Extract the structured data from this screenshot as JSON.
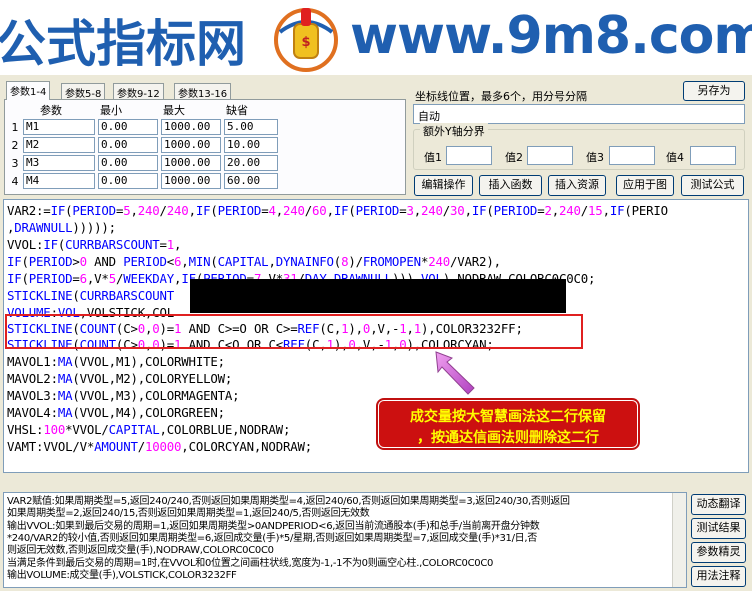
{
  "banner": {
    "left_text": "公式指标网",
    "right_text": "www.9m8.com",
    "logo_text": "9m8.com"
  },
  "tabs": [
    "参数1-4",
    "参数5-8",
    "参数9-12",
    "参数13-16"
  ],
  "params": {
    "headers": [
      "参数",
      "最小",
      "最大",
      "缺省"
    ],
    "rows": [
      {
        "num": "1",
        "name": "M1",
        "min": "0.00",
        "max": "1000.00",
        "default": "5.00"
      },
      {
        "num": "2",
        "name": "M2",
        "min": "0.00",
        "max": "1000.00",
        "default": "10.00"
      },
      {
        "num": "3",
        "name": "M3",
        "min": "0.00",
        "max": "1000.00",
        "default": "20.00"
      },
      {
        "num": "4",
        "name": "M4",
        "min": "0.00",
        "max": "1000.00",
        "default": "60.00"
      }
    ]
  },
  "options": {
    "coord_label": "坐标线位置，最多6个，用分号分隔",
    "coord_value": "自动",
    "saveas_label": "另存为",
    "yaxis_legend": "额外Y轴分界",
    "value_labels": [
      "值1",
      "值2",
      "值3",
      "值4"
    ]
  },
  "buttons": {
    "edit_ops": "编辑操作",
    "insert_func": "插入函数",
    "insert_resource": "插入资源",
    "apply_chart": "应用于图",
    "test_formula": "测试公式"
  },
  "code": {
    "lines": [
      "VAR2:=IF(PERIOD=5,240/240,IF(PERIOD=4,240/60,IF(PERIOD=3,240/30,IF(PERIOD=2,240/15,IF(PERIO",
      ",DRAWNULL)))));",
      "VVOL:IF(CURRBARSCOUNT=1,",
      "IF(PERIOD>0 AND PERIOD<6,MIN(CAPITAL,DYNAINFO(8)/FROMOPEN*240/VAR2),",
      "IF(PERIOD=6,V*5/WEEKDAY,IF(PERIOD=7,V*31/DAY,DRAWNULL))),VOL),NODRAW,COLORC0C0C0;",
      "STICKLINE(CURRBARSCOUNT",
      "VOLUME:VOL,VOLSTICK,COL",
      "STICKLINE(COUNT(C>0,0)=1 AND C>=O OR C>=REF(C,1),0,V,-1,1),COLOR3232FF;",
      "STICKLINE(COUNT(C>0,0)=1 AND C<O OR C<REF(C,1),0,V,-1,0),COLORCYAN;",
      "MAVOL1:MA(VVOL,M1),COLORWHITE;",
      "MAVOL2:MA(VVOL,M2),COLORYELLOW;",
      "MAVOL3:MA(VVOL,M3),COLORMAGENTA;",
      "MAVOL4:MA(VVOL,M4),COLORGREEN;",
      "VHSL:100*VVOL/CAPITAL,COLORBLUE,NODRAW;",
      "VAMT:VVOL/V*AMOUNT/10000,COLORCYAN,NODRAW;"
    ]
  },
  "note": {
    "line1": "成交量按大智慧画法这二行保留",
    "line2": "，按通达信画法则删除这二行"
  },
  "explain": {
    "lines": [
      "VAR2赋值:如果周期类型=5,返回240/240,否则返回如果周期类型=4,返回240/60,否则返回如果周期类型=3,返回240/30,否则返回",
      "如果周期类型=2,返回240/15,否则返回如果周期类型=1,返回240/5,否则返回无效数",
      "输出VVOL:如果到最后交易的周期=1,返回如果周期类型>0ANDPERIOD<6,返回当前流通股本(手)和总手/当前离开盘分钟数",
      "*240/VAR2的较小值,否则返回如果周期类型=6,返回成交量(手)*5/星期,否则返回如果周期类型=7,返回成交量(手)*31/日,否",
      "则返回无效数,否则返回成交量(手),NODRAW,COLORC0C0C0",
      "当满足条件到最后交易的周期=1时,在VVOL和0位置之间画柱状线,宽度为-1,-1不为0则画空心柱.,COLORC0C0C0",
      "输出VOLUME:成交量(手),VOLSTICK,COLOR3232FF"
    ]
  },
  "side_buttons": [
    "动态翻译",
    "测试结果",
    "参数精灵",
    "用法注释"
  ]
}
